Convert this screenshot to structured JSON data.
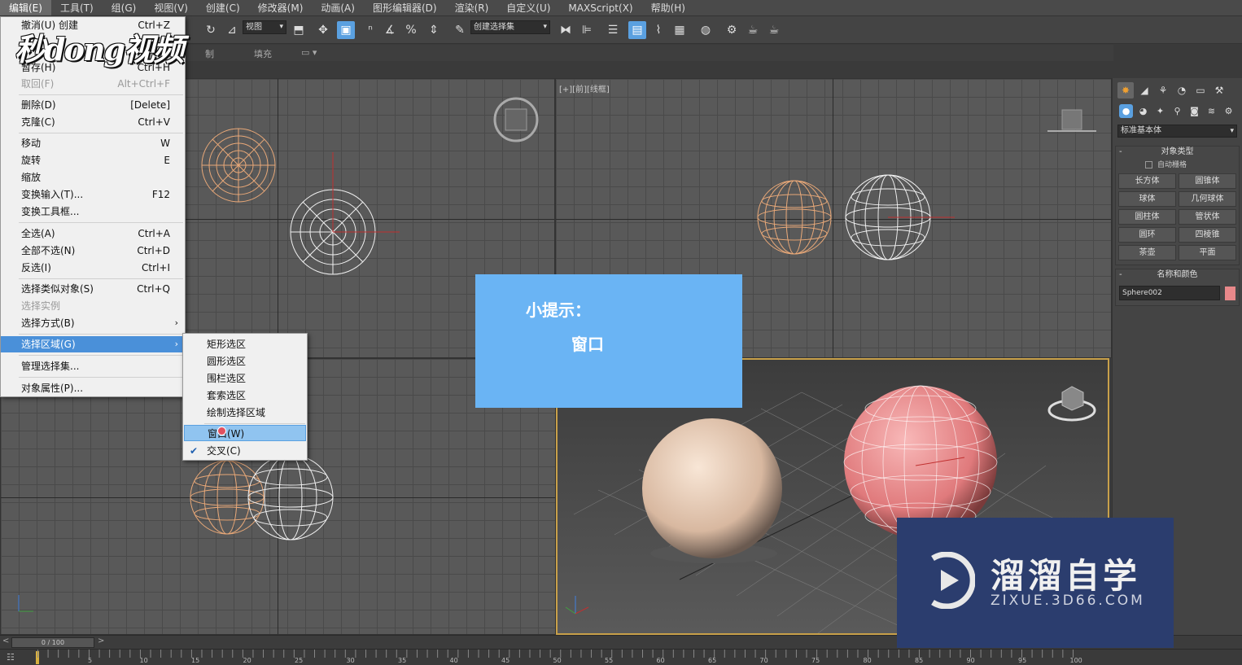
{
  "menubar": {
    "items": [
      "编辑(E)",
      "工具(T)",
      "组(G)",
      "视图(V)",
      "创建(C)",
      "修改器(M)",
      "动画(A)",
      "图形编辑器(D)",
      "渲染(R)",
      "自定义(U)",
      "MAXScript(X)",
      "帮助(H)"
    ]
  },
  "toolbar": {
    "view_dropdown": "视图",
    "selset_dropdown": "创建选择集"
  },
  "ribbon": {
    "item1": "制",
    "item2": "填充"
  },
  "viewports": {
    "front_label": "[+][前][线框]"
  },
  "edit_menu": {
    "items": [
      {
        "label": "撤消(U) 创建",
        "shortcut": "Ctrl+Z",
        "disabled": false
      },
      {
        "label": "暂存(H)",
        "shortcut": "Ctrl+H",
        "disabled": false
      },
      {
        "label": "取回(F)",
        "shortcut": "Alt+Ctrl+F",
        "disabled": true
      },
      {
        "label": "删除(D)",
        "shortcut": "[Delete]",
        "disabled": false
      },
      {
        "label": "克隆(C)",
        "shortcut": "Ctrl+V",
        "disabled": false
      },
      {
        "label": "移动",
        "shortcut": "W",
        "disabled": false
      },
      {
        "label": "旋转",
        "shortcut": "E",
        "disabled": false
      },
      {
        "label": "缩放",
        "shortcut": "",
        "disabled": false
      },
      {
        "label": "变换输入(T)...",
        "shortcut": "F12",
        "disabled": false
      },
      {
        "label": "变换工具框...",
        "shortcut": "",
        "disabled": false
      },
      {
        "label": "全选(A)",
        "shortcut": "Ctrl+A",
        "disabled": false
      },
      {
        "label": "全部不选(N)",
        "shortcut": "Ctrl+D",
        "disabled": false
      },
      {
        "label": "反选(I)",
        "shortcut": "Ctrl+I",
        "disabled": false
      },
      {
        "label": "选择类似对象(S)",
        "shortcut": "Ctrl+Q",
        "disabled": false
      },
      {
        "label": "选择实例",
        "shortcut": "",
        "disabled": true
      },
      {
        "label": "选择方式(B)",
        "shortcut": "",
        "disabled": false
      },
      {
        "label": "选择区域(G)",
        "shortcut": "",
        "disabled": false
      },
      {
        "label": "管理选择集...",
        "shortcut": "",
        "disabled": false
      },
      {
        "label": "对象属性(P)...",
        "shortcut": "",
        "disabled": false
      }
    ]
  },
  "submenu": {
    "items": [
      "矩形选区",
      "圆形选区",
      "围栏选区",
      "套索选区",
      "绘制选择区域",
      "窗口(W)",
      "交叉(C)"
    ]
  },
  "tip": {
    "title": "小提示：",
    "body": "窗口"
  },
  "command_panel": {
    "dropdown": "标准基本体",
    "object_type_header": "对象类型",
    "autogrid": "自动栅格",
    "buttons": [
      "长方体",
      "圆锥体",
      "球体",
      "几何球体",
      "圆柱体",
      "管状体",
      "圆环",
      "四棱锥",
      "茶壶",
      "平面"
    ],
    "name_color_header": "名称和颜色",
    "object_name": "Sphere002",
    "object_color": "#e8888a"
  },
  "timeline": {
    "slider": "0 / 100",
    "ticks": [
      "5",
      "10",
      "15",
      "20",
      "25",
      "30",
      "35",
      "40",
      "45",
      "50",
      "55",
      "60",
      "65",
      "70",
      "75",
      "80",
      "85",
      "90",
      "95",
      "100"
    ]
  },
  "watermarks": {
    "top_left": "秒dong视频",
    "brand": "溜溜自学",
    "url": "ZIXUE.3D66.COM"
  },
  "colors": {
    "accent": "#4a90d9",
    "tip_bg": "#6ab4f4",
    "sphere_orange": "#e8a878",
    "sphere_white": "#f0f0f0",
    "sphere_pink": "#e8888a",
    "persp_border": "#c8a04a"
  }
}
